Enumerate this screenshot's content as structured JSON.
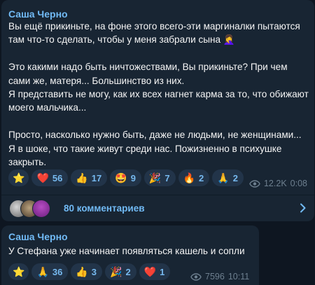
{
  "posts": [
    {
      "author": "Саша Черно",
      "text": "Вы ещё прикиньте, на фоне этого всего-эти маргиналки пытаются там что-то сделать, чтобы у меня забрали сына 🤦‍♀️\n\nЭто какими надо быть ничтожествами, Вы прикиньте? При чем сами же, матеря... Большинство из них.\nЯ представить не могу, как их всех нагнет кармa за то, что обижают моего мальчика...\n\nПросто, насколько нужно быть, даже не людьми, не женщинами... Я в шоке, что такие живут среди нас. Пожизненно в психушке закрыть.",
      "reactions": [
        {
          "emoji": "⭐",
          "count": ""
        },
        {
          "emoji": "❤️",
          "count": "56"
        },
        {
          "emoji": "👍",
          "count": "17"
        },
        {
          "emoji": "🤩",
          "count": "9"
        },
        {
          "emoji": "🎉",
          "count": "7"
        },
        {
          "emoji": "🔥",
          "count": "2"
        },
        {
          "emoji": "🙏",
          "count": "2"
        }
      ],
      "views": "12.2K",
      "time": "0:08",
      "comments_label": "80 комментариев"
    },
    {
      "author": "Саша Черно",
      "text": "У Стефана уже начинает появляться кашель и сопли",
      "reactions": [
        {
          "emoji": "⭐",
          "count": ""
        },
        {
          "emoji": "🙏",
          "count": "36"
        },
        {
          "emoji": "👍",
          "count": "3"
        },
        {
          "emoji": "🎉",
          "count": "2"
        },
        {
          "emoji": "❤️",
          "count": "1"
        }
      ],
      "views": "7596",
      "time": "10:11"
    }
  ],
  "colors": {
    "background": "#0e1621",
    "bubble": "#182533",
    "accent": "#71baf5",
    "meta": "#6d7f8f"
  },
  "icons": {
    "views": "eye-icon",
    "comments_arrow": "chevron-right-icon"
  }
}
